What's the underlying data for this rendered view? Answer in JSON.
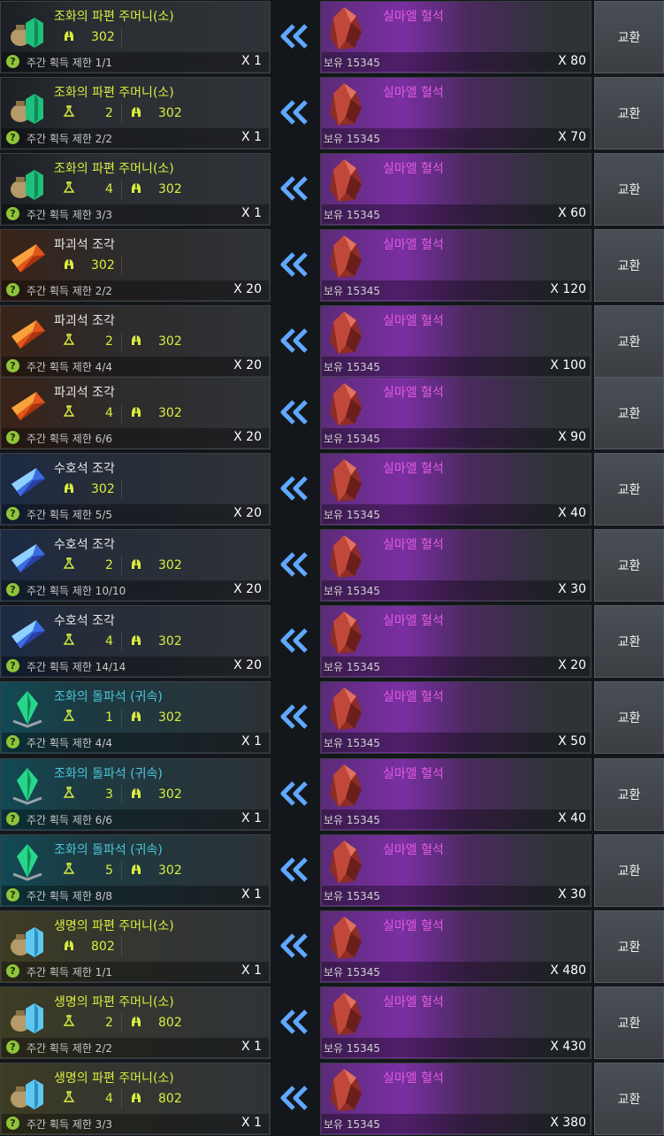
{
  "exchange_list": {
    "button_label": "교환",
    "cost_item": {
      "name": "실마엘 혈석",
      "owned_label": "보유 15345"
    },
    "colors": {
      "yellow_text": "#d9ee3e",
      "cyan_text": "#4cc7dd",
      "purple_text": "#e25ce2",
      "help_green": "#8fc33a"
    },
    "rows": [
      {
        "name": "조화의 파편 주머니(소)",
        "name_color": "yellow",
        "bg": "default",
        "icon": "harmony-pouch-icon",
        "level_req": "",
        "level_req2": "302",
        "limit": "주간 획득 제한 1/1",
        "count": "X 1",
        "cost_count": "X 80"
      },
      {
        "name": "조화의 파편 주머니(소)",
        "name_color": "yellow",
        "bg": "default",
        "icon": "harmony-pouch-icon",
        "level_req": "2",
        "level_req2": "302",
        "limit": "주간 획득 제한 2/2",
        "count": "X 1",
        "cost_count": "X 70"
      },
      {
        "name": "조화의 파편 주머니(소)",
        "name_color": "yellow",
        "bg": "default",
        "icon": "harmony-pouch-icon",
        "level_req": "4",
        "level_req2": "302",
        "limit": "주간 획득 제한 3/3",
        "count": "X 1",
        "cost_count": "X 60"
      },
      {
        "name": "파괴석 조각",
        "name_color": "white",
        "bg": "orange",
        "icon": "destruction-stone-icon",
        "level_req": "",
        "level_req2": "302",
        "limit": "주간 획득 제한 2/2",
        "count": "X 20",
        "cost_count": "X 120"
      },
      {
        "name": "파괴석 조각",
        "name_color": "white",
        "bg": "orange",
        "icon": "destruction-stone-icon",
        "level_req": "2",
        "level_req2": "302",
        "limit": "주간 획득 제한 4/4",
        "count": "X 20",
        "cost_count": "X 100"
      },
      {
        "name": "파괴석 조각",
        "name_color": "white",
        "bg": "orange",
        "icon": "destruction-stone-icon",
        "level_req": "4",
        "level_req2": "302",
        "limit": "주간 획득 제한 6/6",
        "count": "X 20",
        "cost_count": "X 90"
      },
      {
        "name": "수호석 조각",
        "name_color": "white",
        "bg": "blue",
        "icon": "guardian-stone-icon",
        "level_req": "",
        "level_req2": "302",
        "limit": "주간 획득 제한 5/5",
        "count": "X 20",
        "cost_count": "X 40"
      },
      {
        "name": "수호석 조각",
        "name_color": "white",
        "bg": "blue",
        "icon": "guardian-stone-icon",
        "level_req": "2",
        "level_req2": "302",
        "limit": "주간 획득 제한 10/10",
        "count": "X 20",
        "cost_count": "X 30"
      },
      {
        "name": "수호석 조각",
        "name_color": "white",
        "bg": "blue",
        "icon": "guardian-stone-icon",
        "level_req": "4",
        "level_req2": "302",
        "limit": "주간 획득 제한 14/14",
        "count": "X 20",
        "cost_count": "X 20"
      },
      {
        "name": "조화의 돌파석 (귀속)",
        "name_color": "cyan",
        "bg": "teal",
        "icon": "breakthrough-stone-icon",
        "level_req": "1",
        "level_req2": "302",
        "limit": "주간 획득 제한 4/4",
        "count": "X 1",
        "cost_count": "X 50"
      },
      {
        "name": "조화의 돌파석 (귀속)",
        "name_color": "cyan",
        "bg": "teal",
        "icon": "breakthrough-stone-icon",
        "level_req": "3",
        "level_req2": "302",
        "limit": "주간 획득 제한 6/6",
        "count": "X 1",
        "cost_count": "X 40"
      },
      {
        "name": "조화의 돌파석 (귀속)",
        "name_color": "cyan",
        "bg": "teal",
        "icon": "breakthrough-stone-icon",
        "level_req": "5",
        "level_req2": "302",
        "limit": "주간 획득 제한 8/8",
        "count": "X 1",
        "cost_count": "X 30"
      },
      {
        "name": "생명의 파편 주머니(소)",
        "name_color": "yellow",
        "bg": "green",
        "icon": "life-pouch-icon",
        "level_req": "",
        "level_req2": "802",
        "limit": "주간 획득 제한 1/1",
        "count": "X 1",
        "cost_count": "X 480"
      },
      {
        "name": "생명의 파편 주머니(소)",
        "name_color": "yellow",
        "bg": "green",
        "icon": "life-pouch-icon",
        "level_req": "2",
        "level_req2": "802",
        "limit": "주간 획득 제한 2/2",
        "count": "X 1",
        "cost_count": "X 430"
      },
      {
        "name": "생명의 파편 주머니(소)",
        "name_color": "yellow",
        "bg": "green",
        "icon": "life-pouch-icon",
        "level_req": "4",
        "level_req2": "802",
        "limit": "주간 획득 제한 3/3",
        "count": "X 1",
        "cost_count": "X 380"
      }
    ]
  }
}
